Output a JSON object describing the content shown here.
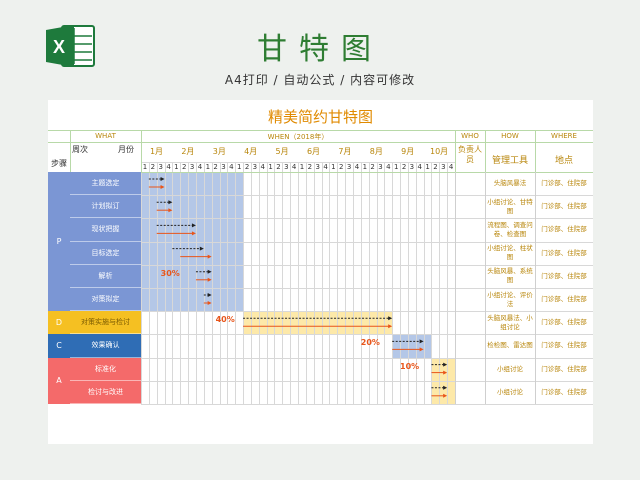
{
  "header": {
    "title": "甘特图",
    "subtitle": "A4打印 / 自动公式 / 内容可修改",
    "logo_icon": "excel-icon"
  },
  "sheet": {
    "title": "精美简约甘特图",
    "what_label": "WHAT",
    "when_label": "WHEN（2018年）",
    "who_label": "WHO",
    "how_label": "HOW",
    "where_label": "WHERE",
    "week_label": "周次",
    "month_label": "月份",
    "step_label": "步骤",
    "owner_header": "负责人员",
    "tools_header": "管理工具",
    "place_header": "地点",
    "months": [
      "1月",
      "2月",
      "3月",
      "4月",
      "5月",
      "6月",
      "7月",
      "8月",
      "9月",
      "10月"
    ],
    "week_numbers": [
      "1",
      "2",
      "3",
      "4"
    ]
  },
  "phases": [
    {
      "label": "P",
      "color": "#7b96d4"
    },
    {
      "label": "D",
      "color": "#f5c022"
    },
    {
      "label": "C",
      "color": "#2f6db5"
    },
    {
      "label": "A",
      "color": "#f46a6a"
    }
  ],
  "tasks": [
    {
      "name": "主题选定",
      "tools": "头脑风暴法",
      "place": "门诊部、住院部"
    },
    {
      "name": "计划拟订",
      "tools": "小组讨论、甘特图",
      "place": "门诊部、住院部"
    },
    {
      "name": "现状把握",
      "tools": "流程图、调查问卷、检查图",
      "place": "门诊部、住院部"
    },
    {
      "name": "目标选定",
      "tools": "小组讨论、柱状图",
      "place": "门诊部、住院部"
    },
    {
      "name": "解析",
      "tools": "头脑风暴、系统图",
      "place": "门诊部、住院部"
    },
    {
      "name": "对策拟定",
      "tools": "小组讨论、评价法",
      "place": "门诊部、住院部"
    },
    {
      "name": "对策实施与检讨",
      "tools": "头脑风暴法、小组讨论",
      "place": "门诊部、住院部"
    },
    {
      "name": "效果确认",
      "tools": "检检图、雷达图",
      "place": "门诊部、住院部"
    },
    {
      "name": "标准化",
      "tools": "小组讨论",
      "place": "门诊部、住院部"
    },
    {
      "name": "检讨与改进",
      "tools": "小组讨论",
      "place": "门诊部、住院部"
    }
  ],
  "percentages": [
    "30%",
    "40%",
    "20%",
    "10%"
  ],
  "colors": {
    "plan_arrow": "#222222",
    "actual_arrow": "#e8551a",
    "plan_shade": "#b4c7e7",
    "do_shade": "#fde9a9",
    "check_shade": "#b4c7e7",
    "act_shade": "#fde9a9"
  }
}
